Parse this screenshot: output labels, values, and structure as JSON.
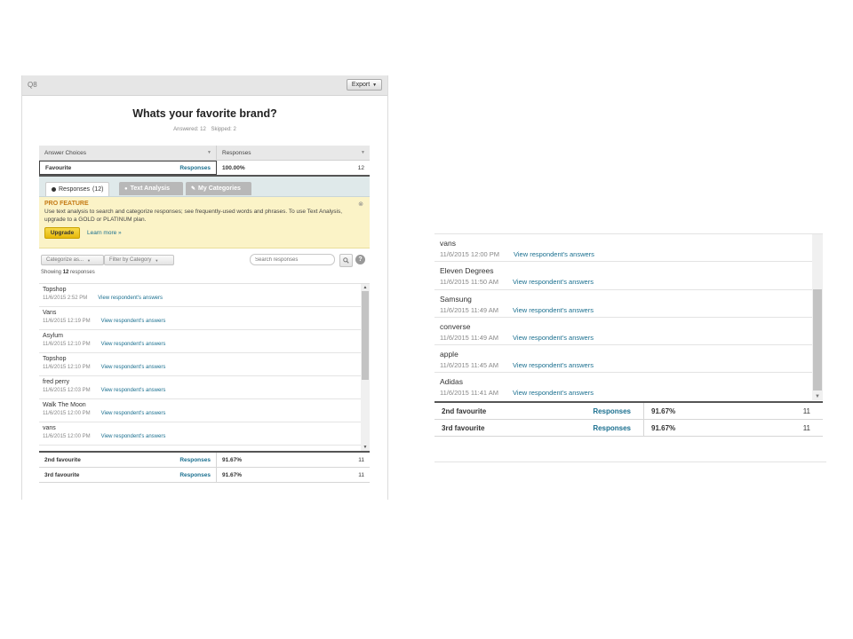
{
  "question": {
    "label": "Q8",
    "export_label": "Export",
    "title": "Whats your favorite brand?",
    "answered": "Answered: 12",
    "skipped": "Skipped: 2"
  },
  "answer_table": {
    "col_choices": "Answer Choices",
    "col_responses": "Responses",
    "row": {
      "choice": "Favourite",
      "link": "Responses",
      "percent": "100.00%",
      "count": "12"
    }
  },
  "tabs": {
    "responses_label": "Responses",
    "responses_count": "(12)",
    "text_analysis": "Text Analysis",
    "my_categories": "My Categories"
  },
  "pro": {
    "title": "PRO FEATURE",
    "text": "Use text analysis to search and categorize responses; see frequently-used words and phrases. To use Text Analysis, upgrade to a GOLD or PLATINUM plan.",
    "upgrade": "Upgrade",
    "learn_more": "Learn more »"
  },
  "filters": {
    "categorize": "Categorize as...",
    "filter_by": "Filter by Category",
    "search_placeholder": "Search responses"
  },
  "showing": {
    "prefix": "Showing",
    "count": "12",
    "suffix": "responses"
  },
  "view_link": "View respondent's answers",
  "left_responses": [
    {
      "name": "Topshop",
      "time": "11/6/2015 2:52 PM"
    },
    {
      "name": "Vans",
      "time": "11/6/2015 12:19 PM"
    },
    {
      "name": "Asylum",
      "time": "11/6/2015 12:10 PM"
    },
    {
      "name": "Topshop",
      "time": "11/6/2015 12:10 PM"
    },
    {
      "name": "fred perry",
      "time": "11/6/2015 12:03 PM"
    },
    {
      "name": "Walk The Moon",
      "time": "11/6/2015 12:00 PM"
    },
    {
      "name": "vans",
      "time": "11/6/2015 12:00 PM"
    }
  ],
  "right_responses": [
    {
      "name": "vans",
      "time": "11/6/2015 12:00 PM"
    },
    {
      "name": "Eleven Degrees",
      "time": "11/6/2015 11:50 AM"
    },
    {
      "name": "Samsung",
      "time": "11/6/2015 11:49 AM"
    },
    {
      "name": "converse",
      "time": "11/6/2015 11:49 AM"
    },
    {
      "name": "apple",
      "time": "11/6/2015 11:45 AM"
    },
    {
      "name": "Adidas",
      "time": "11/6/2015 11:41 AM"
    }
  ],
  "bottom_rows": [
    {
      "choice": "2nd favourite",
      "link": "Responses",
      "percent": "91.67%",
      "count": "11"
    },
    {
      "choice": "3rd favourite",
      "link": "Responses",
      "percent": "91.67%",
      "count": "11"
    }
  ],
  "colors": {
    "link": "#1a6f8f",
    "pro_title": "#c57a14",
    "pro_bg": "#fbf3c7",
    "upgrade": "#e6b80c"
  }
}
